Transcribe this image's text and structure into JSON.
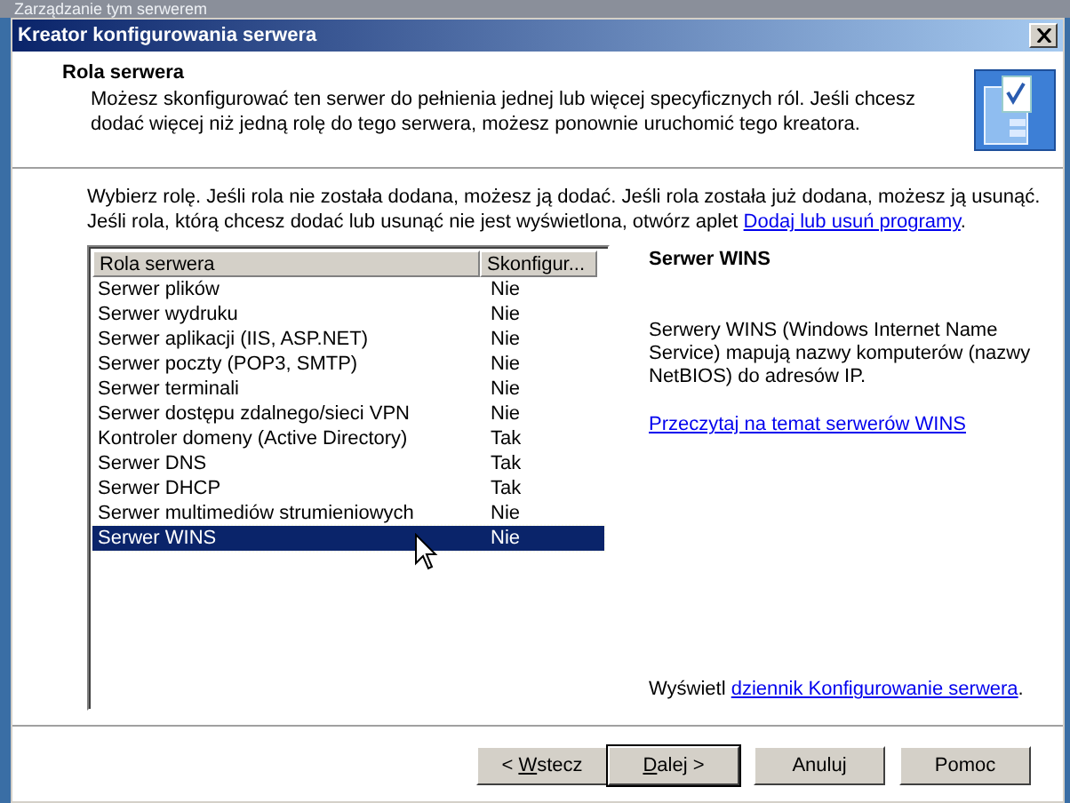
{
  "background_window": {
    "title": "Zarządzanie tym serwerem"
  },
  "window": {
    "title": "Kreator konfigurowania serwera"
  },
  "header": {
    "title": "Rola serwera",
    "description": "Możesz skonfigurować ten serwer do pełnienia jednej lub więcej specyficznych ról. Jeśli chcesz dodać więcej niż jedną rolę do tego serwera, możesz ponownie uruchomić tego kreatora."
  },
  "instructions": {
    "text": "Wybierz rolę. Jeśli rola nie została dodana, możesz ją dodać. Jeśli rola została już dodana, możesz ją usunąć. Jeśli rola, którą chcesz dodać lub usunąć nie jest wyświetlona, otwórz aplet",
    "link": "Dodaj lub usuń programy",
    "suffix": "."
  },
  "table": {
    "columns": [
      "Rola serwera",
      "Skonfigur..."
    ],
    "rows": [
      {
        "role": "Serwer plików",
        "configured": "Nie",
        "selected": false
      },
      {
        "role": "Serwer wydruku",
        "configured": "Nie",
        "selected": false
      },
      {
        "role": "Serwer aplikacji (IIS, ASP.NET)",
        "configured": "Nie",
        "selected": false
      },
      {
        "role": "Serwer poczty (POP3, SMTP)",
        "configured": "Nie",
        "selected": false
      },
      {
        "role": "Serwer terminali",
        "configured": "Nie",
        "selected": false
      },
      {
        "role": "Serwer dostępu zdalnego/sieci VPN",
        "configured": "Nie",
        "selected": false
      },
      {
        "role": "Kontroler domeny (Active Directory)",
        "configured": "Tak",
        "selected": false
      },
      {
        "role": "Serwer DNS",
        "configured": "Tak",
        "selected": false
      },
      {
        "role": "Serwer DHCP",
        "configured": "Tak",
        "selected": false
      },
      {
        "role": "Serwer multimediów strumieniowych",
        "configured": "Nie",
        "selected": false
      },
      {
        "role": "Serwer WINS",
        "configured": "Nie",
        "selected": true
      }
    ]
  },
  "details": {
    "title": "Serwer WINS",
    "description": "Serwery WINS (Windows Internet Name Service) mapują nazwy komputerów (nazwy NetBIOS) do adresów IP.",
    "link": "Przeczytaj na temat serwerów WINS",
    "log_prefix": "Wyświetl",
    "log_link": "dziennik Konfigurowanie serwera",
    "log_suffix": "."
  },
  "buttons": [
    {
      "before": "< ",
      "mnemonic": "W",
      "after": "stecz",
      "default": false
    },
    {
      "mnemonic": "D",
      "after": "alej >",
      "default": true
    },
    {
      "before": "Anuluj",
      "default": false
    },
    {
      "before": "Pomoc",
      "default": false
    }
  ]
}
